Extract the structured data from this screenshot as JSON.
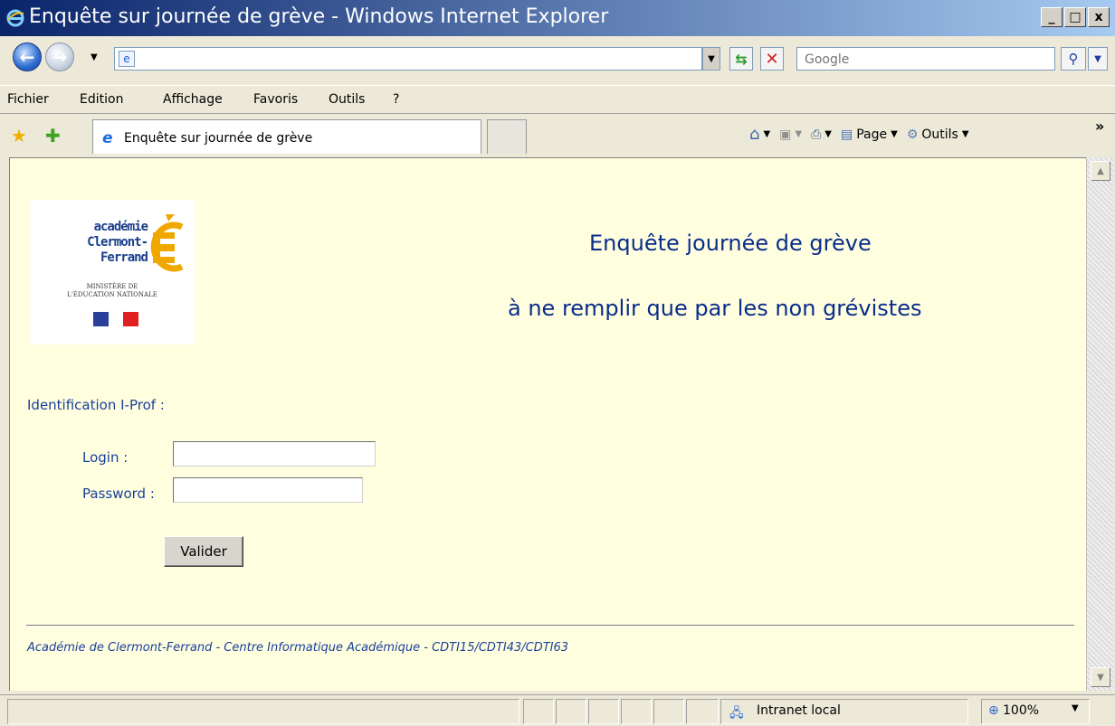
{
  "window": {
    "title": "Enquête sur journée de grève - Windows Internet Explorer",
    "minimize_label": "_",
    "maximize_label": "□",
    "close_label": "x"
  },
  "address_bar": {
    "url": "",
    "search_placeholder": "Google"
  },
  "menu": {
    "items": [
      "Fichier",
      "Edition",
      "Affichage",
      "Favoris",
      "Outils",
      "?"
    ]
  },
  "tab_bar": {
    "active_tab_title": "Enquête sur journée de grève",
    "page_label": "Page",
    "tools_label": "Outils",
    "more_label": "»"
  },
  "page": {
    "logo": {
      "line1": "académie",
      "line2": "Clermont-Ferrand",
      "ministry_line1": "MINISTÈRE DE",
      "ministry_line2": "L'ÉDUCATION NATIONALE",
      "flag_colors": [
        "#2a3f9a",
        "#ffffff",
        "#e02020"
      ]
    },
    "heading_line1": "Enquête journée de grève",
    "heading_line2": "à ne remplir que par les non grévistes",
    "identification_label": "Identification I-Prof :",
    "login_label": "Login :",
    "login_value": "",
    "password_label": "Password :",
    "password_value": "",
    "submit_label": "Valider",
    "footer": "Académie de Clermont-Ferrand - Centre Informatique Académique - CDTI15/CDTI43/CDTI63"
  },
  "status_bar": {
    "zone": "Intranet local",
    "zoom": "100%"
  },
  "colors": {
    "page_background": "#ffffe0",
    "heading_text": "#0a2d8a",
    "label_text": "#1a3f9a",
    "logo_accent": "#f0a800"
  }
}
